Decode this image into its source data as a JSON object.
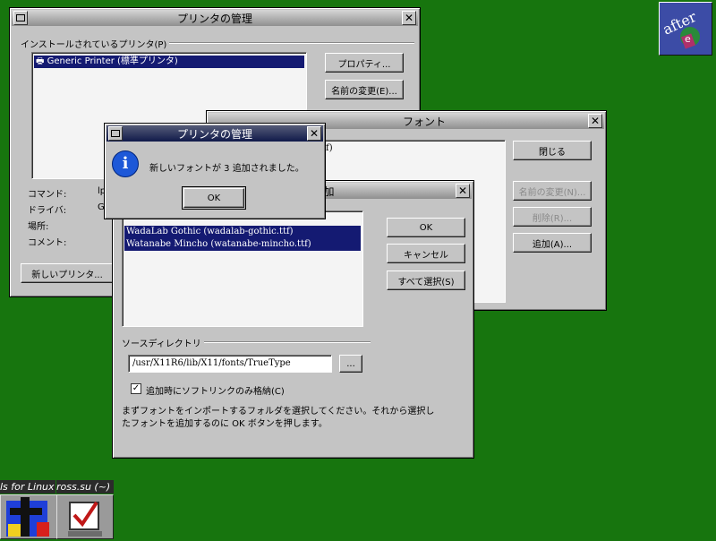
{
  "printer_window": {
    "title": "プリンタの管理",
    "group_label": "インストールされているプリンタ(P)",
    "printers": [
      "Generic Printer (標準プリンタ)"
    ],
    "properties_button": "プロパティ...",
    "rename_button": "名前の変更(E)...",
    "field_labels": [
      "コマンド:",
      "ドライバ:",
      "場所:",
      "コメント:"
    ],
    "field_values": [
      "lp",
      "G",
      "",
      ""
    ],
    "new_printer_button": "新しいプリンタ..."
  },
  "font_window": {
    "title": "フォント",
    "list_fragment": "ttf)",
    "close_button": "閉じる",
    "rename_button": "名前の変更(N)...",
    "delete_button": "削除(R)...",
    "add_button": "追加(A)..."
  },
  "add_font_window": {
    "title_fragment": "加",
    "fonts": [
      "WadaLab Gothic (wadalab-gothic.ttf)",
      "Watanabe Mincho (watanabe-mincho.ttf)"
    ],
    "ok_button": "OK",
    "cancel_button": "キャンセル",
    "select_all_button": "すべて選択(S)",
    "source_dir_label": "ソースディレクトリ",
    "source_dir_value": "/usr/X11R6/lib/X11/fonts/TrueType",
    "browse_button": "...",
    "symlink_label": "追加時にソフトリンクのみ格納(C)",
    "symlink_checked": true,
    "description_line1": "まずフォントをインポートするフォルダを選択してください。それから選択し",
    "description_line2": "たフォントを追加するのに OK ボタンを押します。"
  },
  "message_dialog": {
    "title": "プリンタの管理",
    "message": "新しいフォントが 3 追加されました。",
    "ok_button": "OK"
  },
  "taskbar": {
    "item1": "ls for Linux",
    "item2": "ross.su (~)"
  },
  "logo": {
    "text": "afterstep"
  },
  "colors": {
    "desktop": "#17750e",
    "selection": "#141a72",
    "window": "#c4c4c4"
  }
}
